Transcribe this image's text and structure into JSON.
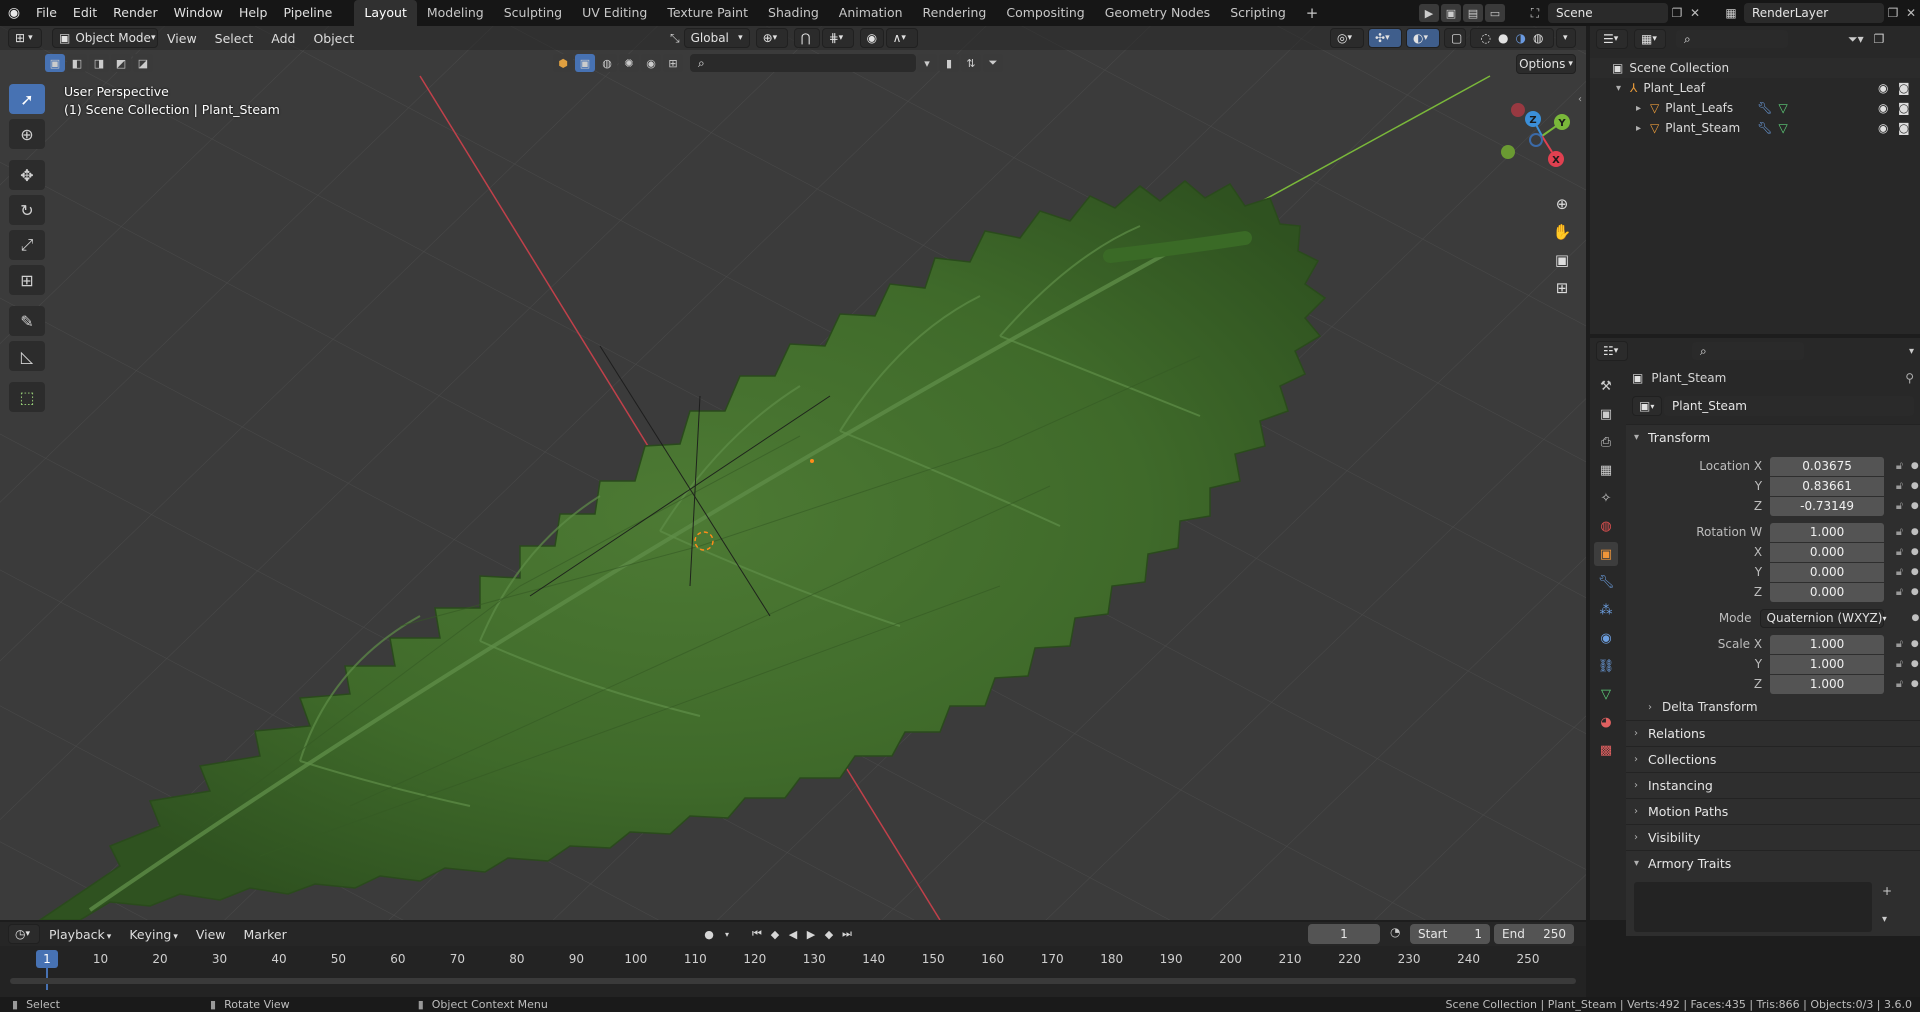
{
  "menus": [
    "File",
    "Edit",
    "Render",
    "Window",
    "Help",
    "Pipeline"
  ],
  "workspaces": [
    {
      "label": "Layout",
      "active": true
    },
    {
      "label": "Modeling"
    },
    {
      "label": "Sculpting"
    },
    {
      "label": "UV Editing"
    },
    {
      "label": "Texture Paint"
    },
    {
      "label": "Shading"
    },
    {
      "label": "Animation"
    },
    {
      "label": "Rendering"
    },
    {
      "label": "Compositing"
    },
    {
      "label": "Geometry Nodes"
    },
    {
      "label": "Scripting"
    }
  ],
  "topbar": {
    "add_tab": "+",
    "scene": "Scene",
    "render_layer": "RenderLayer"
  },
  "viewport": {
    "mode": "Object Mode",
    "menus": [
      "View",
      "Select",
      "Add",
      "Object"
    ],
    "transform_orientation": "Global",
    "options_label": "Options",
    "overlay_title": "User Perspective",
    "overlay_subtitle": "(1) Scene Collection | Plant_Steam",
    "gizmo": {
      "x": "X",
      "y": "Y",
      "z": "Z"
    }
  },
  "outliner": {
    "root": "Scene Collection",
    "items": [
      {
        "name": "Plant_Leaf",
        "level": 1
      },
      {
        "name": "Plant_Leafs",
        "level": 2
      },
      {
        "name": "Plant_Steam",
        "level": 2
      }
    ]
  },
  "properties": {
    "object_name": "Plant_Steam",
    "data_name": "Plant_Steam",
    "transform_title": "Transform",
    "location": {
      "label": "Location X",
      "x": "0.03675",
      "y": "0.83661",
      "z": "-0.73149"
    },
    "rotation": {
      "label": "Rotation W",
      "w": "1.000",
      "x": "0.000",
      "y": "0.000",
      "z": "0.000"
    },
    "axis_labels": {
      "x": "X",
      "y": "Y",
      "z": "Z"
    },
    "mode_label": "Mode",
    "mode_value": "Quaternion (WXYZ)",
    "scale": {
      "label": "Scale X",
      "x": "1.000",
      "y": "1.000",
      "z": "1.000"
    },
    "delta_transform": "Delta Transform",
    "panels": [
      "Relations",
      "Collections",
      "Instancing",
      "Motion Paths",
      "Visibility",
      "Armory Traits"
    ]
  },
  "timeline": {
    "menus": [
      "Playback",
      "Keying",
      "View",
      "Marker"
    ],
    "current_frame": "1",
    "start_label": "Start",
    "start_value": "1",
    "end_label": "End",
    "end_value": "250",
    "ticks": [
      "1",
      "10",
      "20",
      "30",
      "40",
      "50",
      "60",
      "70",
      "80",
      "90",
      "100",
      "110",
      "120",
      "130",
      "140",
      "150",
      "160",
      "170",
      "180",
      "190",
      "200",
      "210",
      "220",
      "230",
      "240",
      "250"
    ]
  },
  "statusbar": {
    "select": "Select",
    "rotate": "Rotate View",
    "context": "Object Context Menu",
    "info": "Scene Collection | Plant_Steam | Verts:492 | Faces:435 | Tris:866 | Objects:0/3 | 3.6.0"
  },
  "colors": {
    "accent": "#4772b3",
    "x_axis": "#e04050",
    "y_axis": "#7ab83a",
    "z_axis": "#3b8fd8",
    "leaf": "#3f6a2a"
  }
}
